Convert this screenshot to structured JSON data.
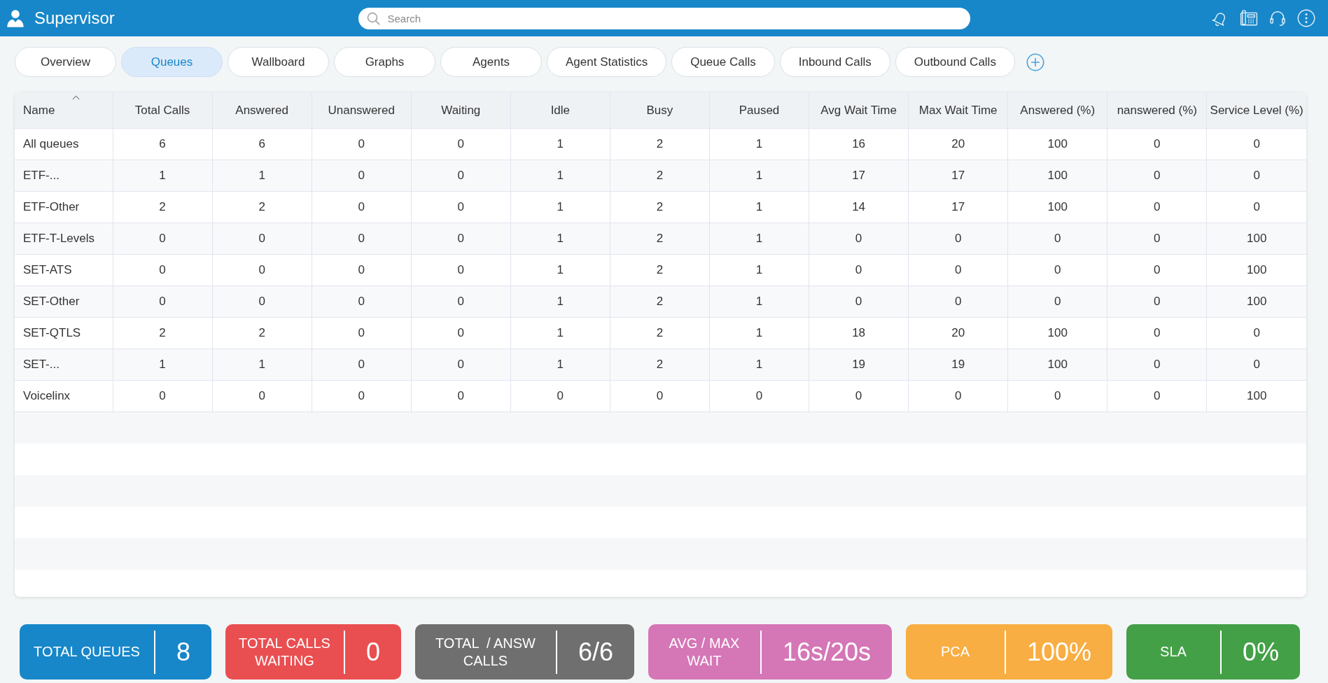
{
  "header": {
    "title": "Supervisor",
    "search": {
      "placeholder": "Search"
    }
  },
  "tabs": [
    {
      "label": "Overview",
      "selected": false
    },
    {
      "label": "Queues",
      "selected": true
    },
    {
      "label": "Wallboard",
      "selected": false
    },
    {
      "label": "Graphs",
      "selected": false
    },
    {
      "label": "Agents",
      "selected": false
    },
    {
      "label": "Agent Statistics",
      "selected": false
    },
    {
      "label": "Queue Calls",
      "selected": false
    },
    {
      "label": "Inbound Calls",
      "selected": false
    },
    {
      "label": "Outbound Calls",
      "selected": false
    }
  ],
  "table": {
    "columns": [
      {
        "label": "Name",
        "sorted": true
      },
      {
        "label": "Total Calls",
        "sorted": false
      },
      {
        "label": "Answered",
        "sorted": false
      },
      {
        "label": "Unanswered",
        "sorted": false
      },
      {
        "label": "Waiting",
        "sorted": false
      },
      {
        "label": "Idle",
        "sorted": false
      },
      {
        "label": "Busy",
        "sorted": false
      },
      {
        "label": "Paused",
        "sorted": false
      },
      {
        "label": "Avg Wait Time",
        "sorted": false
      },
      {
        "label": "Max Wait Time",
        "sorted": false
      },
      {
        "label": "Answered (%)",
        "sorted": false
      },
      {
        "label": "nanswered (%)",
        "sorted": false
      },
      {
        "label": "Service Level (%)",
        "sorted": false
      }
    ],
    "rows": [
      [
        "All queues",
        "6",
        "6",
        "0",
        "0",
        "1",
        "2",
        "1",
        "16",
        "20",
        "100",
        "0",
        "0"
      ],
      [
        "ETF-...",
        "1",
        "1",
        "0",
        "0",
        "1",
        "2",
        "1",
        "17",
        "17",
        "100",
        "0",
        "0"
      ],
      [
        "ETF-Other",
        "2",
        "2",
        "0",
        "0",
        "1",
        "2",
        "1",
        "14",
        "17",
        "100",
        "0",
        "0"
      ],
      [
        "ETF-T-Levels",
        "0",
        "0",
        "0",
        "0",
        "1",
        "2",
        "1",
        "0",
        "0",
        "0",
        "0",
        "100"
      ],
      [
        "SET-ATS",
        "0",
        "0",
        "0",
        "0",
        "1",
        "2",
        "1",
        "0",
        "0",
        "0",
        "0",
        "100"
      ],
      [
        "SET-Other",
        "0",
        "0",
        "0",
        "0",
        "1",
        "2",
        "1",
        "0",
        "0",
        "0",
        "0",
        "100"
      ],
      [
        "SET-QTLS",
        "2",
        "2",
        "0",
        "0",
        "1",
        "2",
        "1",
        "18",
        "20",
        "100",
        "0",
        "0"
      ],
      [
        "SET-...",
        "1",
        "1",
        "0",
        "0",
        "1",
        "2",
        "1",
        "19",
        "19",
        "100",
        "0",
        "0"
      ],
      [
        "Voicelinx",
        "0",
        "0",
        "0",
        "0",
        "0",
        "0",
        "0",
        "0",
        "0",
        "0",
        "0",
        "100"
      ]
    ]
  },
  "summary_cards": [
    {
      "label": "TOTAL QUEUES",
      "value": "8",
      "color": "#1787c9"
    },
    {
      "label": "TOTAL CALLS WAITING",
      "value": "0",
      "color": "#e94f51"
    },
    {
      "label": "TOTAL  / ANSW CALLS",
      "value": "6/6",
      "color": "#6f6f6f"
    },
    {
      "label": "AVG / MAX WAIT",
      "value": "16s/20s",
      "color": "#d576b6"
    },
    {
      "label": "PCA",
      "value": "100%",
      "color": "#f8ae42"
    },
    {
      "label": "SLA",
      "value": "0%",
      "color": "#43a047"
    }
  ]
}
